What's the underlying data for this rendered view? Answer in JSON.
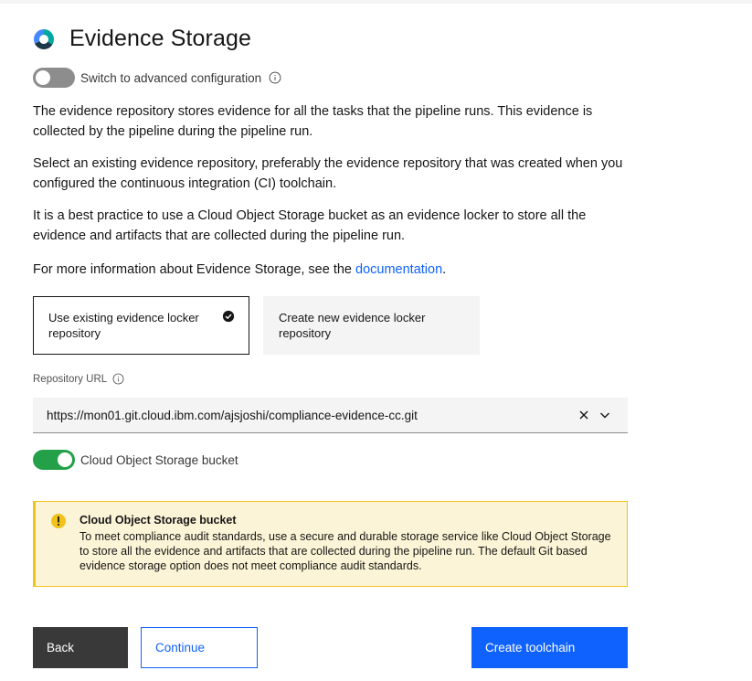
{
  "header": {
    "title": "Evidence Storage",
    "logo": "ibm-cloud-devops-logo"
  },
  "advanced": {
    "label": "Switch to advanced configuration",
    "enabled": false
  },
  "paragraphs": {
    "p1": "The evidence repository stores evidence for all the tasks that the pipeline runs. This evidence is collected by the pipeline during the pipeline run.",
    "p2": "Select an existing evidence repository, preferably the evidence repository that was created when you configured the continuous integration (CI) toolchain.",
    "p3": "It is a best practice to use a Cloud Object Storage bucket as an evidence locker to store all the evidence and artifacts that are collected during the pipeline run.",
    "p4_prefix": "For more information about Evidence Storage, see the ",
    "p4_link": "documentation",
    "p4_suffix": "."
  },
  "tiles": {
    "existing": {
      "label": "Use existing evidence locker repository",
      "selected": true
    },
    "create": {
      "label": "Create new evidence locker repository",
      "selected": false
    }
  },
  "repo_url": {
    "label": "Repository URL",
    "value": "https://mon01.git.cloud.ibm.com/ajsjoshi/compliance-evidence-cc.git"
  },
  "cos": {
    "label": "Cloud Object Storage bucket",
    "enabled": true
  },
  "notification": {
    "title": "Cloud Object Storage bucket",
    "body": "To meet compliance audit standards, use a secure and durable storage service like Cloud Object Storage to store all the evidence and artifacts that are collected during the pipeline run. The default Git based evidence storage option does not meet compliance audit standards.",
    "kind": "warning"
  },
  "buttons": {
    "back": "Back",
    "continue": "Continue",
    "create": "Create toolchain"
  },
  "colors": {
    "primary": "#0f62fe",
    "toggle_on": "#24a148",
    "toggle_off": "#8d8d8d",
    "warning_bg": "#fcf4d6",
    "warning_border": "#f1c21b",
    "secondary_button": "#393939"
  }
}
